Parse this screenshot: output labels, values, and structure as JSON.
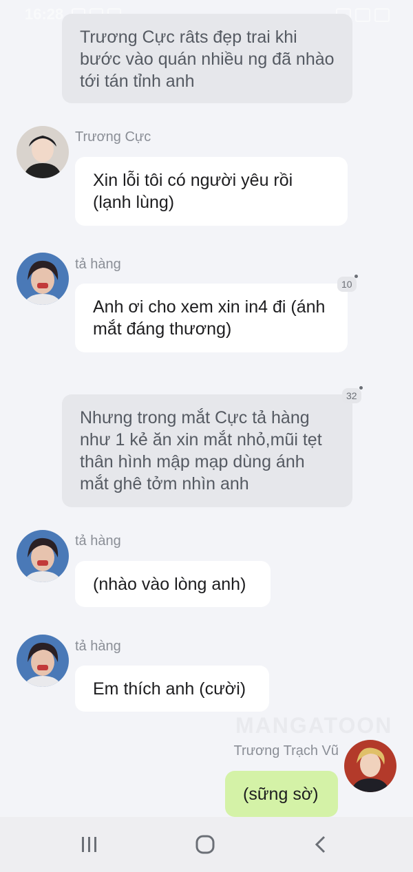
{
  "status_bar": {
    "time": "16:28"
  },
  "watermark": "MANGATOON",
  "messages": {
    "m1": {
      "text": "Trương Cực râts đẹp trai khi bước vào quán nhiều ng đã nhào tới tán tỉnh anh"
    },
    "m2": {
      "sender": "Trương Cực",
      "text": "Xin lỗi tôi có người yêu rồi (lạnh lùng)"
    },
    "m3": {
      "sender": "tả hàng",
      "text": "Anh ơi cho xem xin in4 đi (ánh mắt đáng thương)",
      "comment_count": "10"
    },
    "m4": {
      "text": "Nhưng trong mắt Cực tả hàng như 1 kẻ ăn xin mắt nhỏ,mũi tẹt thân hình mập mạp dùng ánh mắt ghê tởm nhìn anh",
      "comment_count": "32"
    },
    "m5": {
      "sender": "tả hàng",
      "text": "(nhào vào lòng anh)"
    },
    "m6": {
      "sender": "tả hàng",
      "text": "Em thích anh (cười)"
    },
    "m7": {
      "sender": "Trương Trạch Vũ",
      "text": "(sững sờ)"
    }
  },
  "colors": {
    "background": "#f3f4f8",
    "narration_bubble": "#e6e7eb",
    "incoming_bubble": "#ffffff",
    "outgoing_bubble": "#d4f2a7"
  },
  "nav_bar": {
    "icons": [
      "recent-apps-icon",
      "home-icon",
      "back-icon"
    ]
  }
}
